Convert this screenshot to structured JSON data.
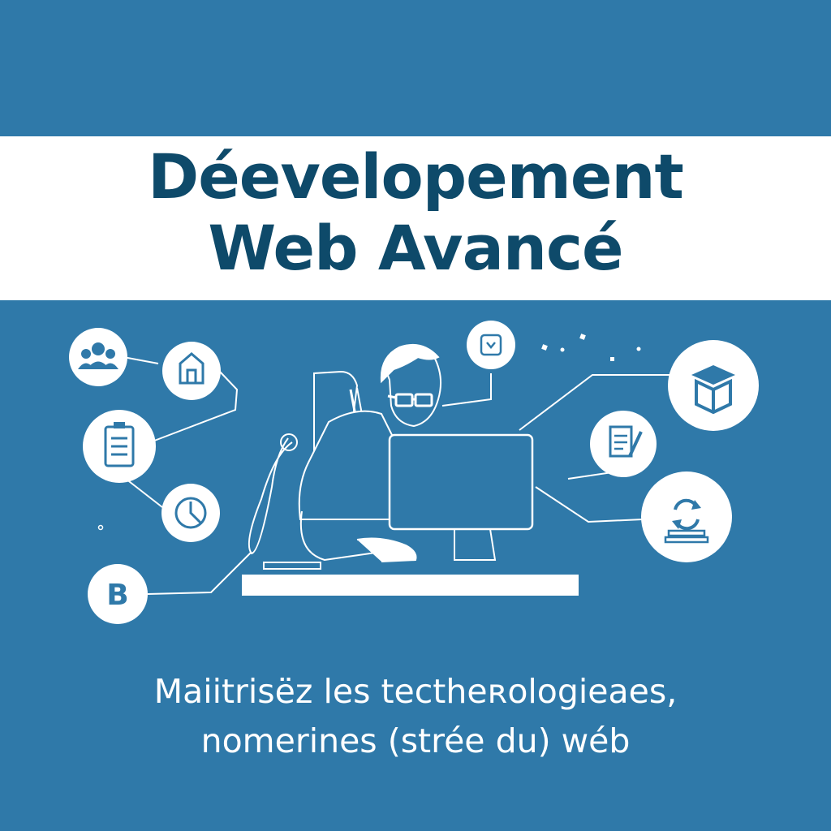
{
  "header": {
    "title_line1": "Déevelopement",
    "title_line2": "Web Avancé"
  },
  "footer": {
    "subtitle_line1": "Maiitrisëz les tectheʀologieaes,",
    "subtitle_line2": "nomerines (strée du) wéb"
  },
  "badges": {
    "b_letter": "B"
  },
  "colors": {
    "background": "#2f79a9",
    "title_band": "#ffffff",
    "title_text": "#0e4a6a",
    "line_art": "#ffffff",
    "icon_ink": "#2f79a9"
  },
  "icons": [
    "people-icon",
    "home-icon",
    "checklist-icon",
    "clock-icon",
    "b-letter-icon",
    "code-icon",
    "box-icon",
    "document-edit-icon",
    "sync-icon"
  ]
}
